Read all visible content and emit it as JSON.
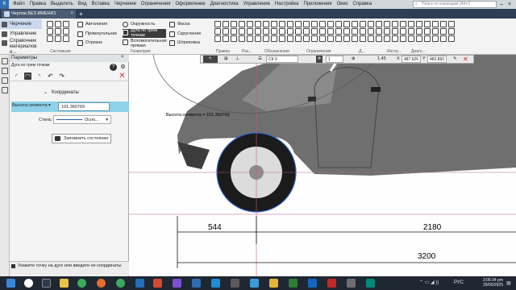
{
  "app": {
    "title": "КОМПАС-3D"
  },
  "menu": {
    "items": [
      "Файл",
      "Правка",
      "Выделить",
      "Вид",
      "Вставка",
      "Черчение",
      "Ограничения",
      "Оформление",
      "Диагностика",
      "Управление",
      "Настройка",
      "Приложения",
      "Окно",
      "Справка"
    ],
    "search_placeholder": "Поиск по командам (Alt+/)"
  },
  "tabs": {
    "doc_title": "Чертеж БЕЗ ИМЕНИ1",
    "close": "×",
    "add": "+"
  },
  "ribbon": {
    "categories": [
      "Черчение",
      "Управление",
      "Справочник материалов и..."
    ],
    "tools_col1": [
      "Автолиния",
      "Прямоугольник",
      "Отрезок"
    ],
    "tools_col2": [
      "Окружность",
      "Дуга по трем точкам",
      "Вспомогательная прямая"
    ],
    "tools_col3": [
      "Фаска",
      "Скругление",
      "Штриховка"
    ],
    "groups": [
      "Системная",
      "Геометрия",
      "Правка",
      "Раз...",
      "Обозначения",
      "Ограничения",
      "Д...",
      "Инстр...",
      "Диагн..."
    ]
  },
  "panel": {
    "title": "Параметры",
    "command": "Дуга по трем точкам",
    "coords_header": "Координаты",
    "field_label": "Высота сегмента",
    "field_value": "101.360769",
    "style_label": "Стиль:",
    "style_value": "Осно...",
    "save_state": "Запомнить состояние",
    "hint": "Укажите точку на дуге или введите ее координаты"
  },
  "drawing_toolbar": {
    "layer": "СК 0",
    "scale": "1",
    "zoom": "1.45",
    "x_label": "X",
    "x_value": "487.626",
    "y_label": "Y",
    "y_value": "483.860"
  },
  "drawing": {
    "tooltip": "Высота сегмента = 101.360769",
    "dim1": "544",
    "dim2": "2180",
    "dim3": "3200"
  },
  "taskbar": {
    "lang": "РУС",
    "time": "3:05:34 pm",
    "date": "29/05/2025"
  }
}
